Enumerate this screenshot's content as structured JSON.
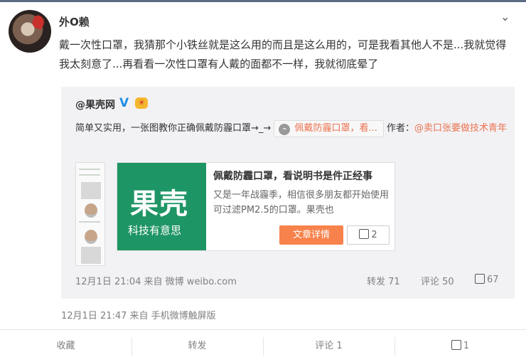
{
  "post": {
    "username": "外O赖",
    "text": "戴一次性口罩，我猜那个小铁丝就是这么用的而且是这么用的，可是我看其他人不是...我就觉得我太刻意了...再看看一次性口罩有人戴的面都不一样，我就彻底晕了",
    "meta": "12月1日 21:47 来自 手机微博触屏版"
  },
  "repost": {
    "source_name": "@果壳网",
    "verified_mark": "V",
    "badge_text": "☀",
    "text_prefix": "简单又实用，一张图教你正确佩戴防霾口罩→_→",
    "link_label": "佩戴防霾口罩，看...",
    "author_prefix": "作者：",
    "author_mention": "@卖口张要做技术青年",
    "card": {
      "image_title": "果壳",
      "image_subtitle": "科技有意思",
      "title": "佩戴防霾口罩，看说明书是件正经事",
      "summary": "又是一年战霾季，相信很多朋友都开始使用可过滤PM2.5的口罩。果壳也",
      "read_button": "文章详情",
      "like_count": "2"
    },
    "meta": "12月1日 21:04 来自 微博 weibo.com",
    "repost_label": "转发 71",
    "comment_label": "评论 50",
    "like_label": "67"
  },
  "actions": {
    "favorite": "收藏",
    "repost": "转发",
    "comment": "评论 1",
    "like": "1"
  },
  "icons": {
    "chevron": "chevron-down-icon",
    "link": "link-icon",
    "like": "thumb-up-icon"
  },
  "colors": {
    "accent": "#eb7350",
    "verified": "#1f8fe6",
    "card_green": "#1e9564",
    "button_orange": "#f7824b"
  }
}
